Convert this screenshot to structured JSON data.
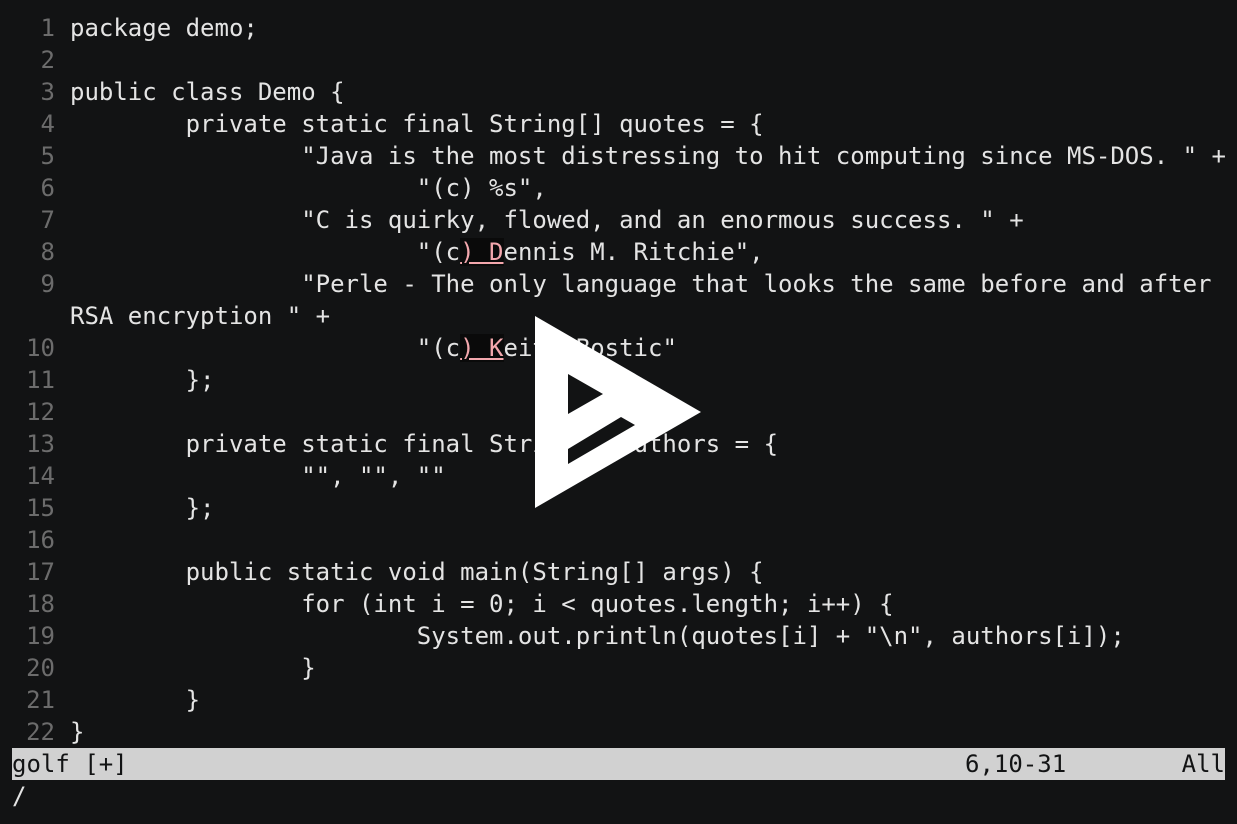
{
  "editor": {
    "lines": [
      {
        "num": "1",
        "pre": "package demo;",
        "hl": "",
        "post": ""
      },
      {
        "num": "2",
        "pre": "",
        "hl": "",
        "post": ""
      },
      {
        "num": "3",
        "pre": "public class Demo {",
        "hl": "",
        "post": ""
      },
      {
        "num": "4",
        "pre": "        private static final String[] quotes = {",
        "hl": "",
        "post": ""
      },
      {
        "num": "5",
        "pre": "                \"Java is the most distressing to hit computing since MS-DOS. \" +",
        "hl": "",
        "post": ""
      },
      {
        "num": "6",
        "pre": "                        \"(c) %s\",",
        "hl": "",
        "post": ""
      },
      {
        "num": "7",
        "pre": "                \"C is quirky, flowed, and an enormous success. \" +",
        "hl": "",
        "post": ""
      },
      {
        "num": "8",
        "pre": "                        \"(c",
        "hl": ") D",
        "post": "ennis M. Ritchie\","
      },
      {
        "num": "9",
        "pre": "                \"Perle - The only language that looks the same before and after",
        "hl": "",
        "post": ""
      },
      {
        "num": "",
        "pre": "RSA encryption \" +",
        "hl": "",
        "post": ""
      },
      {
        "num": "10",
        "pre": "                        \"(c",
        "hl": ") K",
        "post": "eith Bostic\""
      },
      {
        "num": "11",
        "pre": "        };",
        "hl": "",
        "post": ""
      },
      {
        "num": "12",
        "pre": "",
        "hl": "",
        "post": ""
      },
      {
        "num": "13",
        "pre": "        private static final String[] authors = {",
        "hl": "",
        "post": ""
      },
      {
        "num": "14",
        "pre": "                \"\", \"\", \"\"",
        "hl": "",
        "post": ""
      },
      {
        "num": "15",
        "pre": "        };",
        "hl": "",
        "post": ""
      },
      {
        "num": "16",
        "pre": "",
        "hl": "",
        "post": ""
      },
      {
        "num": "17",
        "pre": "        public static void main(String[] args) {",
        "hl": "",
        "post": ""
      },
      {
        "num": "18",
        "pre": "                for (int i = 0; i < quotes.length; i++) {",
        "hl": "",
        "post": ""
      },
      {
        "num": "19",
        "pre": "                        System.out.println(quotes[i] + \"\\n\", authors[i]);",
        "hl": "",
        "post": ""
      },
      {
        "num": "20",
        "pre": "                }",
        "hl": "",
        "post": ""
      },
      {
        "num": "21",
        "pre": "        }",
        "hl": "",
        "post": ""
      },
      {
        "num": "22",
        "pre": "}",
        "hl": "",
        "post": ""
      }
    ]
  },
  "status": {
    "filename": "golf [+]",
    "position": "6,10-31",
    "scroll": "All"
  },
  "command": {
    "text": "/"
  },
  "overlay": {
    "icon": "play-icon",
    "color": "#ffffff"
  }
}
